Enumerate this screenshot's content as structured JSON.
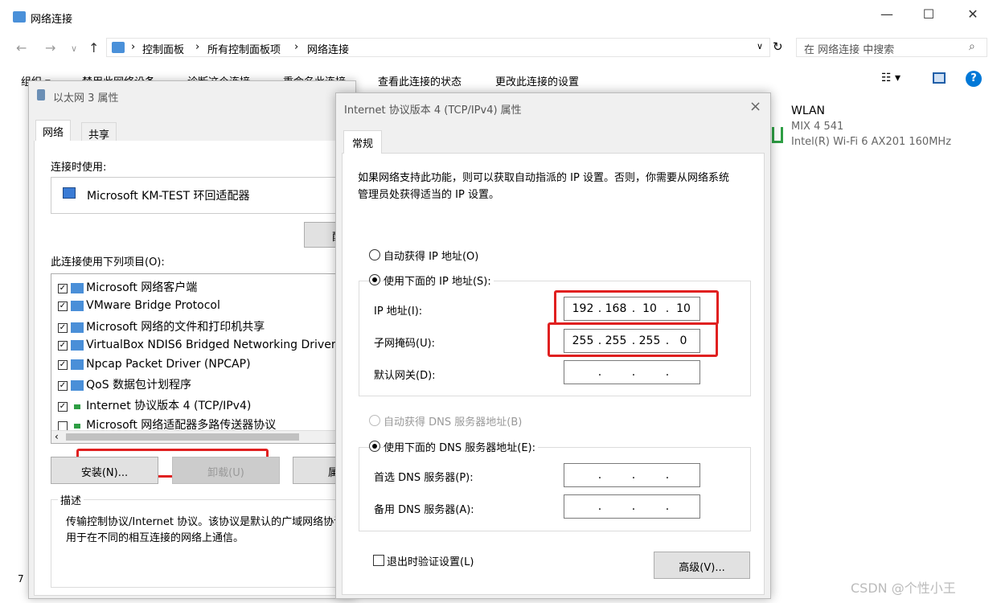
{
  "explorer": {
    "title": "网络连接",
    "search_placeholder": "在 网络连接 中搜索",
    "breadcrumb": [
      "控制面板",
      "所有控制面板项",
      "网络连接"
    ],
    "commands": [
      "组织 ▾",
      "禁用此网络设备",
      "诊断这个连接",
      "重命名此连接",
      "查看此连接的状态",
      "更改此连接的设置"
    ],
    "wlan": {
      "name": "WLAN",
      "network": "MIX 4 541",
      "adapter": "Intel(R) Wi-Fi 6 AX201 160MHz"
    },
    "status_left": "7"
  },
  "eth_dialog": {
    "title": "以太网 3 属性",
    "tabs": [
      "网络",
      "共享"
    ],
    "connect_using_label": "连接时使用:",
    "adapter": "Microsoft KM-TEST 环回适配器",
    "config_btn": "配",
    "items_label": "此连接使用下列项目(O):",
    "items": [
      {
        "label": "Microsoft 网络客户端",
        "checked": true
      },
      {
        "label": "VMware Bridge Protocol",
        "checked": true
      },
      {
        "label": "Microsoft 网络的文件和打印机共享",
        "checked": true
      },
      {
        "label": "VirtualBox NDIS6 Bridged Networking Driver",
        "checked": true
      },
      {
        "label": "Npcap Packet Driver (NPCAP)",
        "checked": true
      },
      {
        "label": "QoS 数据包计划程序",
        "checked": true
      },
      {
        "label": "Internet 协议版本 4 (TCP/IPv4)",
        "checked": true
      },
      {
        "label": "Microsoft 网络适配器多路传送器协议",
        "checked": false
      }
    ],
    "install_btn": "安装(N)...",
    "uninstall_btn": "卸载(U)",
    "props_btn": "属",
    "desc_label": "描述",
    "description": "传输控制协议/Internet 协议。该协议是默认的广域网络协议，用于在不同的相互连接的网络上通信。"
  },
  "ipv4_dialog": {
    "title": "Internet 协议版本 4 (TCP/IPv4) 属性",
    "tab": "常规",
    "intro": "如果网络支持此功能，则可以获取自动指派的 IP 设置。否则，你需要从网络系统管理员处获得适当的 IP 设置。",
    "auto_ip": "自动获得 IP 地址(O)",
    "manual_ip": "使用下面的 IP 地址(S):",
    "ip_label": "IP 地址(I):",
    "ip": [
      "192",
      "168",
      "10",
      "10"
    ],
    "mask_label": "子网掩码(U):",
    "mask": [
      "255",
      "255",
      "255",
      "0"
    ],
    "gateway_label": "默认网关(D):",
    "auto_dns": "自动获得 DNS 服务器地址(B)",
    "manual_dns": "使用下面的 DNS 服务器地址(E):",
    "dns1_label": "首选 DNS 服务器(P):",
    "dns2_label": "备用 DNS 服务器(A):",
    "validate": "退出时验证设置(L)",
    "advanced_btn": "高级(V)...",
    "close": "×"
  },
  "watermark": "CSDN @个性小王",
  "colors": {
    "highlight": "#e02020",
    "link_blue": "#0078d7"
  }
}
